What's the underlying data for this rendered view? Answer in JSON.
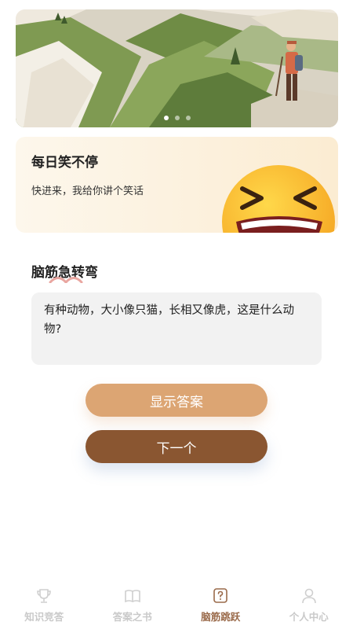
{
  "banner": {
    "slides": 3,
    "active_slide": 1
  },
  "joke_card": {
    "title": "每日笑不停",
    "subtitle": "快进来，我给你讲个笑话"
  },
  "riddle": {
    "section_title": "脑筋急转弯",
    "question": "有种动物，大小像只猫，长相又像虎，这是什么动物?",
    "show_answer_label": "显示答案",
    "next_label": "下一个"
  },
  "tabbar": {
    "tabs": [
      {
        "label": "知识竞答",
        "icon": "trophy-icon",
        "active": false
      },
      {
        "label": "答案之书",
        "icon": "book-icon",
        "active": false
      },
      {
        "label": "脑筋跳跃",
        "icon": "question-box-icon",
        "active": true
      },
      {
        "label": "个人中心",
        "icon": "user-icon",
        "active": false
      }
    ]
  },
  "colors": {
    "show_answer_button": "#dca573",
    "next_button": "#8a5631",
    "active_tab": "#9a6a4a",
    "inactive_tab": "#c9c9c9"
  }
}
